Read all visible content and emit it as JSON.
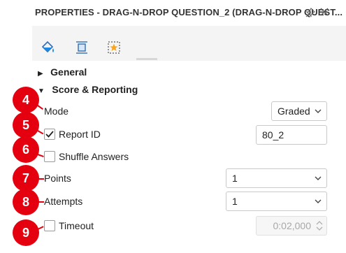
{
  "panel": {
    "title": "PROPERTIES - DRAG-N-DROP QUESTION_2 (DRAG-N-DROP QUEST..."
  },
  "tabs": [
    {
      "icon": "paint-bucket-icon",
      "active": false
    },
    {
      "icon": "resize-icon",
      "active": false
    },
    {
      "icon": "star-frame-icon",
      "active": true
    }
  ],
  "sections": {
    "general": "General",
    "score_reporting": "Score & Reporting"
  },
  "fields": {
    "mode": {
      "label": "Mode",
      "value": "Graded"
    },
    "report_id": {
      "label": "Report ID",
      "checked": true,
      "value": "80_2"
    },
    "shuffle_answers": {
      "label": "Shuffle Answers",
      "checked": false
    },
    "points": {
      "label": "Points",
      "value": "1"
    },
    "attempts": {
      "label": "Attempts",
      "value": "1"
    },
    "timeout": {
      "label": "Timeout",
      "checked": false,
      "value": "0:02,000"
    }
  },
  "badges": [
    "4",
    "5",
    "6",
    "7",
    "8",
    "9"
  ],
  "colors": {
    "badge": "#e4000f",
    "accent_icon": "#1e88e5",
    "tab_icon": "#2f6db5",
    "star": "#f5a623"
  }
}
